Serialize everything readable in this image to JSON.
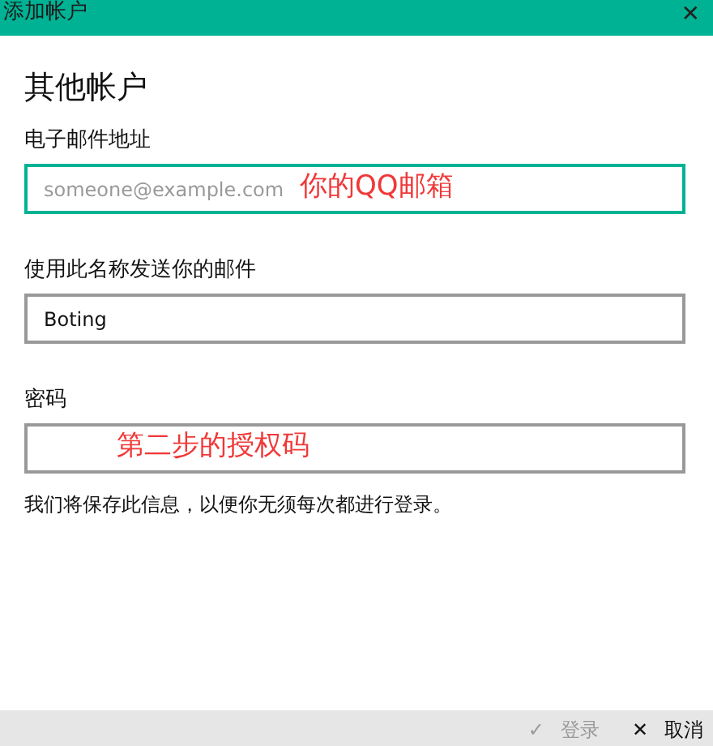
{
  "window": {
    "title": "添加帐户",
    "close": "✕"
  },
  "heading": "其他帐户",
  "fields": [
    {
      "label": "电子邮件地址",
      "placeholder": "someone@example.com",
      "focused": true,
      "annotation": "你的QQ邮箱"
    },
    {
      "label": "使用此名称发送你的邮件",
      "value": "Boting",
      "focused": false
    },
    {
      "label": "密码",
      "focused": false,
      "annotation": "第二步的授权码"
    }
  ],
  "note": "我们将保存此信息，以便你无须每次都进行登录。",
  "buttons": [
    {
      "icon": "✓",
      "label": "登录",
      "disabled": true
    },
    {
      "icon": "✕",
      "label": "取消",
      "disabled": false
    }
  ]
}
